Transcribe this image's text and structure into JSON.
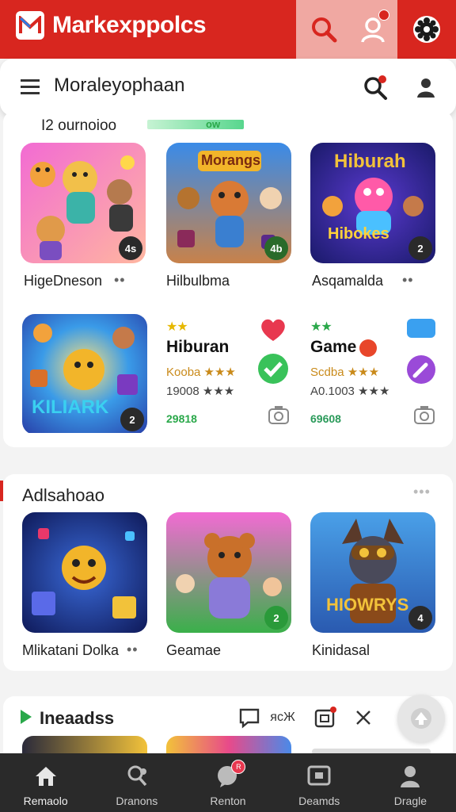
{
  "app": {
    "title": "Markexppolcs"
  },
  "header": {
    "search_text": "Moraleyophaan"
  },
  "section1": {
    "title": "I2 ournoioo",
    "green_text": "ow",
    "tiles": [
      {
        "label": "HigeDneson",
        "badge": "4s",
        "dots": "••"
      },
      {
        "label": "Hilbulbma",
        "badge": "4b",
        "title_art": "Morangs"
      },
      {
        "label": "Asqamalda",
        "badge": "2",
        "dots": "••",
        "title_art": "Hiburah",
        "sub_art": "Hibokes"
      },
      {
        "label": "",
        "badge": "2",
        "title_art": "KILIARK"
      }
    ],
    "info_cards": [
      {
        "title": "Hiburan",
        "row1": "Kooba ★★★",
        "row2": "19008 ★★★",
        "num": "29818"
      },
      {
        "title": "Game",
        "row1": "Scdba ★★★",
        "row2": "A0.1003 ★★★",
        "num": "69608"
      }
    ]
  },
  "section2": {
    "title": "Adlsahoao",
    "tiles": [
      {
        "label": "Mlikatani Dolka",
        "dots": "••"
      },
      {
        "label": "Geamae",
        "badge": "2"
      },
      {
        "label": "Kinidasal",
        "badge": "4",
        "title_art": "HIOWRYS"
      }
    ]
  },
  "section3": {
    "title": "Ineaadss",
    "action_text": "ясЖ"
  },
  "bottom_nav": {
    "items": [
      {
        "label": "Remaolo",
        "icon": "home-icon"
      },
      {
        "label": "Dranons",
        "icon": "search-people-icon"
      },
      {
        "label": "Renton",
        "icon": "chat-icon",
        "badge": "R"
      },
      {
        "label": "Deamds",
        "icon": "window-icon"
      },
      {
        "label": "Dragle",
        "icon": "profile-icon"
      }
    ]
  },
  "colors": {
    "primary": "#d8261f",
    "success": "#2aa84a",
    "nav_bg": "#2a2a2a"
  }
}
